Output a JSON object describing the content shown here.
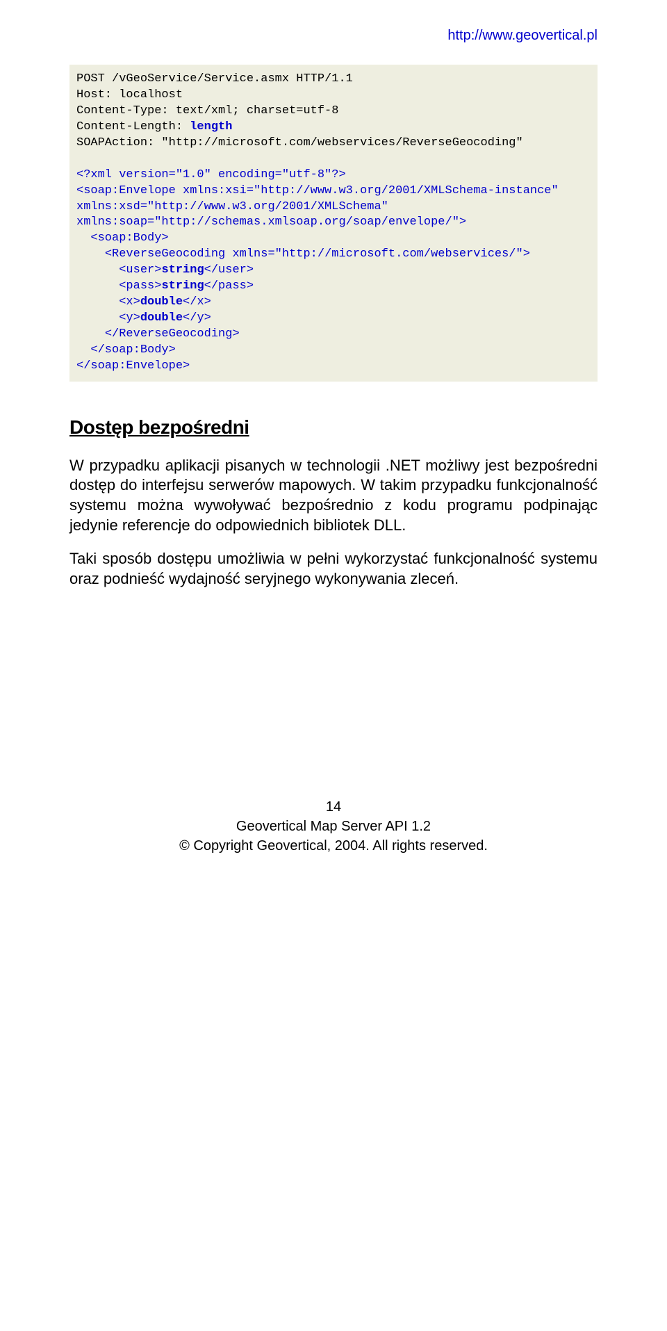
{
  "header": {
    "url": "http://www.geovertical.pl"
  },
  "code": {
    "l1a": "POST /vGeoService/Service.asmx HTTP/1.1",
    "l2a": "Host: localhost",
    "l3a": "Content-Type: text/xml; charset=utf-8",
    "l4a": "Content-Length: ",
    "l4b": "length",
    "l5a": "SOAPAction: \"http://microsoft.com/webservices/ReverseGeocoding\"",
    "l6a": "",
    "l7a": "<?xml version=\"1.0\" encoding=\"utf-8\"?>",
    "l8a": "<soap:Envelope xmlns:xsi=\"http://www.w3.org/2001/XMLSchema-instance\" xmlns:xsd=\"http://www.w3.org/2001/XMLSchema\" xmlns:soap=\"http://schemas.xmlsoap.org/soap/envelope/\">",
    "l9a": "  <soap:Body>",
    "l10a": "    <ReverseGeocoding xmlns=\"http://microsoft.com/webservices/\">",
    "l11a": "      <user>",
    "l11b": "string",
    "l11c": "</user>",
    "l12a": "      <pass>",
    "l12b": "string",
    "l12c": "</pass>",
    "l13a": "      <x>",
    "l13b": "double",
    "l13c": "</x>",
    "l14a": "      <y>",
    "l14b": "double",
    "l14c": "</y>",
    "l15a": "    </ReverseGeocoding>",
    "l16a": "  </soap:Body>",
    "l17a": "</soap:Envelope>"
  },
  "section": {
    "heading": "Dostęp bezpośredni",
    "para1": "W przypadku aplikacji pisanych w technologii .NET możliwy jest bezpośredni dostęp do interfejsu serwerów mapowych. W takim przypadku funkcjonalność systemu można wywoływać bezpośrednio z kodu programu podpinając jedynie referencje do odpowiednich bibliotek DLL.",
    "para2": "Taki sposób dostępu umożliwia w pełni wykorzystać funkcjonalność systemu oraz podnieść wydajność seryjnego wykonywania zleceń."
  },
  "footer": {
    "page_number": "14",
    "line1": "Geovertical Map Server API 1.2",
    "line2": "© Copyright Geovertical, 2004. All rights reserved."
  }
}
